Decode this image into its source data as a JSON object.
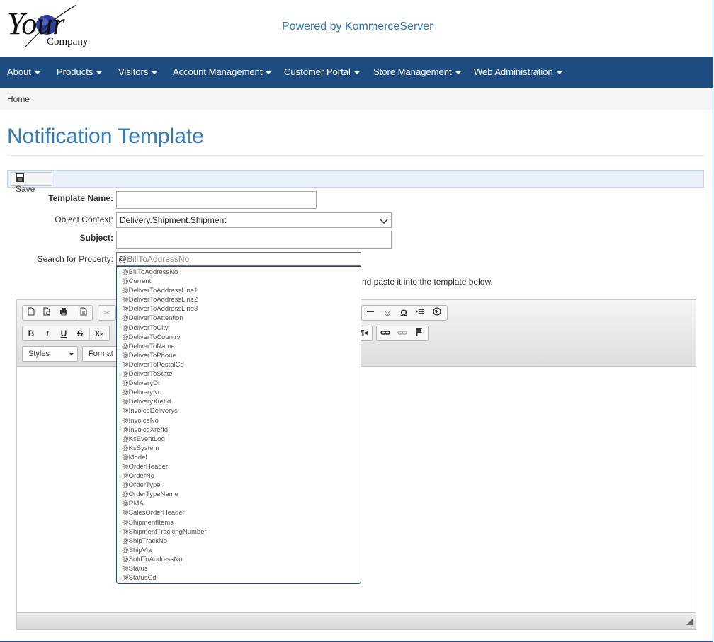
{
  "brand": {
    "logo_main": "Your",
    "logo_sub": "Company",
    "powered_by": "Powered by KommerceServer"
  },
  "nav": {
    "items": [
      {
        "label": "About"
      },
      {
        "label": "Products"
      },
      {
        "label": "Visitors"
      },
      {
        "label": "Account Management"
      },
      {
        "label": "Customer Portal"
      },
      {
        "label": "Store Management"
      },
      {
        "label": "Web Administration"
      }
    ]
  },
  "breadcrumb": {
    "home": "Home"
  },
  "page": {
    "title": "Notification Template"
  },
  "toolbar": {
    "save_label": "Save"
  },
  "form": {
    "template_name_label": "Template Name:",
    "template_name_value": "",
    "object_context_label": "Object Context:",
    "object_context_value": "Delivery.Shipment.Shipment",
    "subject_label": "Subject:",
    "subject_value": "",
    "search_label": "Search for Property:",
    "search_value": "@",
    "search_placeholder_rest": "BillToAddressNo",
    "hint_text": "nd paste it into the template below."
  },
  "editor": {
    "styles_label": "Styles",
    "format_label": "Format"
  },
  "suggestions": [
    "@BillToAddressNo",
    "@Current",
    "@DeliverToAddressLine1",
    "@DeliverToAddressLine2",
    "@DeliverToAddressLine3",
    "@DeliverToAttention",
    "@DeliverToCity",
    "@DeliverToCountry",
    "@DeliverToName",
    "@DeliverToPhone",
    "@DeliverToPostalCd",
    "@DeliverToState",
    "@DeliveryDt",
    "@DeliveryNo",
    "@DeliveryXrefId",
    "@InvoiceDeliverys",
    "@InvoiceNo",
    "@InvoiceXrefId",
    "@KsEventLog",
    "@KsSystem",
    "@Model",
    "@OrderHeader",
    "@OrderNo",
    "@OrderType",
    "@OrderTypeName",
    "@RMA",
    "@SalesOrderHeader",
    "@ShipmentItems",
    "@ShipmentTrackingNumber",
    "@ShipTrackNo",
    "@ShipVia",
    "@SoldToAddressNo",
    "@Status",
    "@StatusCd"
  ],
  "colors": {
    "navbar": "#1e4c7f",
    "title": "#337ab7"
  }
}
